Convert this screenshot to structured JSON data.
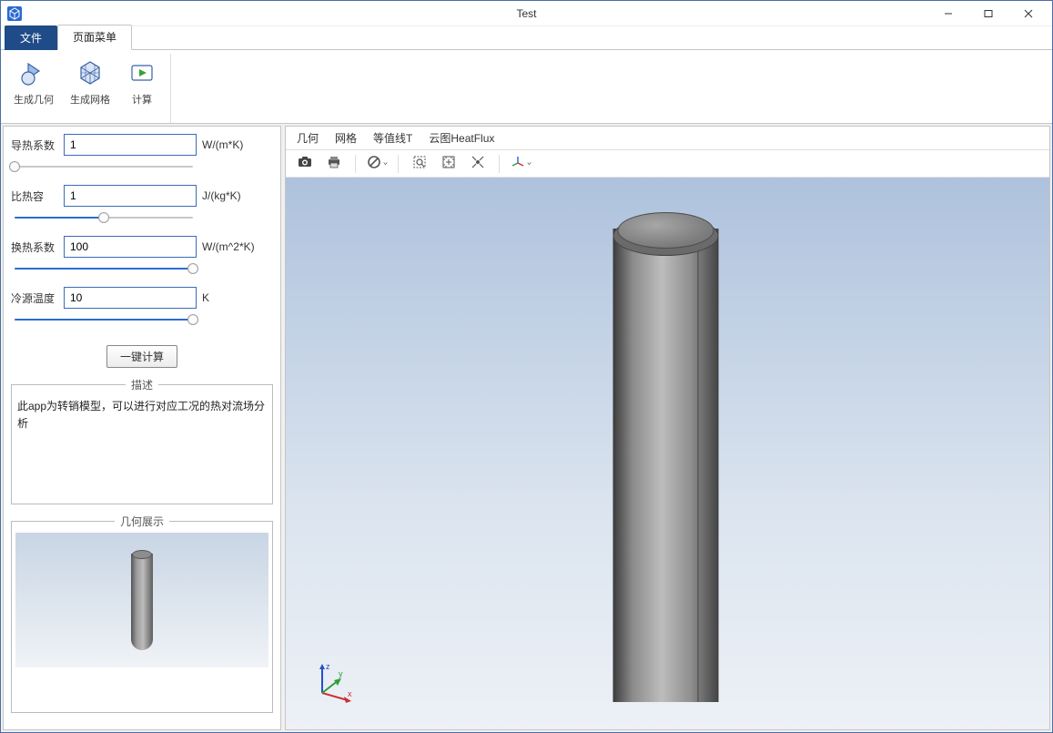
{
  "window": {
    "title": "Test"
  },
  "menu": {
    "file": "文件",
    "pageMenu": "页面菜单"
  },
  "ribbon": {
    "genGeometry": "生成几何",
    "genMesh": "生成网格",
    "compute": "计算"
  },
  "params": {
    "thermal_cond": {
      "label": "导热系数",
      "value": "1",
      "unit": "W/(m*K)",
      "pos": 0
    },
    "specific_heat": {
      "label": "比热容",
      "value": "1",
      "unit": "J/(kg*K)",
      "pos": 50
    },
    "heat_transfer": {
      "label": "换热系数",
      "value": "100",
      "unit": "W/(m^2*K)",
      "pos": 100
    },
    "cold_source_temp": {
      "label": "冷源温度",
      "value": "10",
      "unit": "K",
      "pos": 100
    }
  },
  "buttons": {
    "oneKeyCompute": "一键计算"
  },
  "boxes": {
    "descTitle": "描述",
    "descText": "此app为转销模型，可以进行对应工况的热对流场分析",
    "geomTitle": "几何展示"
  },
  "viewerTabs": {
    "geometry": "几何",
    "mesh": "网格",
    "isolineT": "等值线T",
    "cloudHeatFlux": "云图HeatFlux"
  },
  "axis": {
    "x": "x",
    "y": "y",
    "z": "z"
  }
}
